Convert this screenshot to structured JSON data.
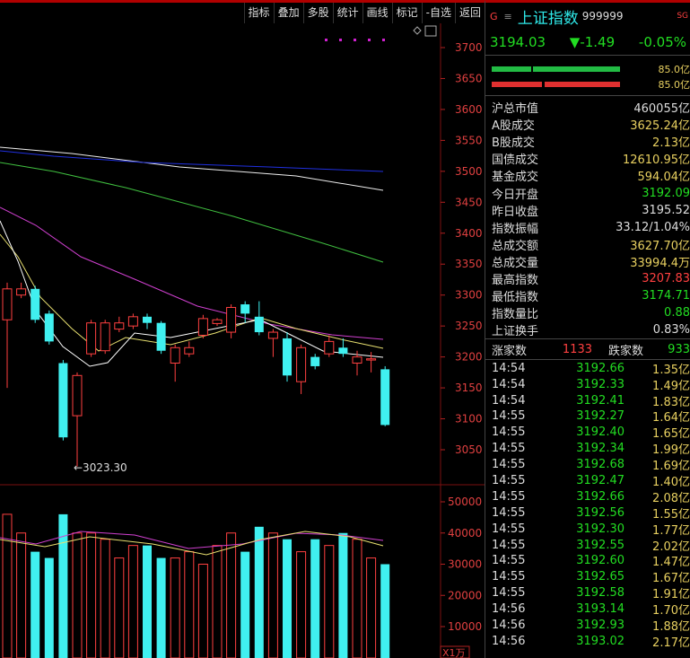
{
  "toolbar": [
    "指标",
    "叠加",
    "多股",
    "统计",
    "画线",
    "标记",
    "-自选",
    "返回"
  ],
  "header": {
    "g": "G",
    "menu": "≡",
    "name": "上证指数",
    "code": "999999",
    "tag": "SG",
    "price": "3194.03",
    "change": "▼-1.49",
    "pct": "-0.05%"
  },
  "volume_bars": [
    {
      "value": "85.0亿"
    },
    {
      "value": "85.0亿"
    }
  ],
  "stats": [
    {
      "label": "沪总市值",
      "value": "460055亿",
      "color": "#dddddd"
    },
    {
      "label": "A股成交",
      "value": "3625.24亿",
      "color": "#e8d060"
    },
    {
      "label": "B股成交",
      "value": "2.13亿",
      "color": "#e8d060"
    },
    {
      "label": "国债成交",
      "value": "12610.95亿",
      "color": "#e8d060"
    },
    {
      "label": "基金成交",
      "value": "594.04亿",
      "color": "#e8d060"
    },
    {
      "label": "今日开盘",
      "value": "3192.09",
      "color": "#22dd22"
    },
    {
      "label": "昨日收盘",
      "value": "3195.52",
      "color": "#dddddd"
    },
    {
      "label": "指数振幅",
      "value": "33.12/1.04%",
      "color": "#dddddd"
    },
    {
      "label": "总成交额",
      "value": "3627.70亿",
      "color": "#e8d060"
    },
    {
      "label": "总成交量",
      "value": "33994.4万",
      "color": "#e8d060"
    },
    {
      "label": "最高指数",
      "value": "3207.83",
      "color": "#ff4040"
    },
    {
      "label": "最低指数",
      "value": "3174.71",
      "color": "#22dd22"
    },
    {
      "label": "指数量比",
      "value": "0.88",
      "color": "#22dd22"
    },
    {
      "label": "上证换手",
      "value": "0.83%",
      "color": "#dddddd"
    }
  ],
  "updown": {
    "up_label": "涨家数",
    "up": "1133",
    "down_label": "跌家数",
    "down": "933"
  },
  "ticks": [
    [
      "14:54",
      "3192.66",
      "1.35亿"
    ],
    [
      "14:54",
      "3192.33",
      "1.49亿"
    ],
    [
      "14:54",
      "3192.41",
      "1.83亿"
    ],
    [
      "14:55",
      "3192.27",
      "1.64亿"
    ],
    [
      "14:55",
      "3192.40",
      "1.65亿"
    ],
    [
      "14:55",
      "3192.34",
      "1.99亿"
    ],
    [
      "14:55",
      "3192.68",
      "1.69亿"
    ],
    [
      "14:55",
      "3192.47",
      "1.40亿"
    ],
    [
      "14:55",
      "3192.66",
      "2.08亿"
    ],
    [
      "14:55",
      "3192.56",
      "1.55亿"
    ],
    [
      "14:55",
      "3192.30",
      "1.77亿"
    ],
    [
      "14:55",
      "3192.55",
      "2.02亿"
    ],
    [
      "14:55",
      "3192.60",
      "1.47亿"
    ],
    [
      "14:55",
      "3192.65",
      "1.67亿"
    ],
    [
      "14:55",
      "3192.58",
      "1.91亿"
    ],
    [
      "14:56",
      "3193.14",
      "1.70亿"
    ],
    [
      "14:56",
      "3192.93",
      "1.88亿"
    ],
    [
      "14:56",
      "3193.02",
      "2.17亿"
    ]
  ],
  "chart_data": {
    "type": "candlestick",
    "price_axis": [
      3700,
      3650,
      3600,
      3550,
      3500,
      3450,
      3400,
      3350,
      3300,
      3250,
      3200,
      3150,
      3100,
      3050
    ],
    "volume_axis": [
      50000,
      40000,
      30000,
      20000,
      10000
    ],
    "volume_unit": "X1万",
    "low_annotation": "←3023.30",
    "candles": [
      {
        "o": 3260,
        "c": 3310,
        "h": 3320,
        "l": 3150
      },
      {
        "o": 3300,
        "c": 3310,
        "h": 3320,
        "l": 3295
      },
      {
        "o": 3310,
        "c": 3260,
        "h": 3315,
        "l": 3255
      },
      {
        "o": 3270,
        "c": 3225,
        "h": 3275,
        "l": 3220
      },
      {
        "o": 3190,
        "c": 3070,
        "h": 3195,
        "l": 3065
      },
      {
        "o": 3105,
        "c": 3170,
        "h": 3175,
        "l": 3023
      },
      {
        "o": 3205,
        "c": 3255,
        "h": 3260,
        "l": 3200
      },
      {
        "o": 3210,
        "c": 3255,
        "h": 3260,
        "l": 3205
      },
      {
        "o": 3245,
        "c": 3255,
        "h": 3265,
        "l": 3240
      },
      {
        "o": 3250,
        "c": 3265,
        "h": 3270,
        "l": 3245
      },
      {
        "o": 3265,
        "c": 3255,
        "h": 3270,
        "l": 3245
      },
      {
        "o": 3255,
        "c": 3210,
        "h": 3258,
        "l": 3205
      },
      {
        "o": 3190,
        "c": 3215,
        "h": 3220,
        "l": 3160
      },
      {
        "o": 3205,
        "c": 3215,
        "h": 3225,
        "l": 3200
      },
      {
        "o": 3235,
        "c": 3262,
        "h": 3268,
        "l": 3230
      },
      {
        "o": 3254,
        "c": 3260,
        "h": 3263,
        "l": 3250
      },
      {
        "o": 3240,
        "c": 3280,
        "h": 3285,
        "l": 3230
      },
      {
        "o": 3285,
        "c": 3270,
        "h": 3290,
        "l": 3255
      },
      {
        "o": 3265,
        "c": 3240,
        "h": 3290,
        "l": 3235
      },
      {
        "o": 3230,
        "c": 3240,
        "h": 3245,
        "l": 3200
      },
      {
        "o": 3230,
        "c": 3170,
        "h": 3240,
        "l": 3160
      },
      {
        "o": 3160,
        "c": 3215,
        "h": 3220,
        "l": 3140
      },
      {
        "o": 3200,
        "c": 3185,
        "h": 3205,
        "l": 3180
      },
      {
        "o": 3205,
        "c": 3225,
        "h": 3235,
        "l": 3200
      },
      {
        "o": 3215,
        "c": 3205,
        "h": 3230,
        "l": 3200
      },
      {
        "o": 3190,
        "c": 3200,
        "h": 3210,
        "l": 3170
      },
      {
        "o": 3195,
        "c": 3197,
        "h": 3208,
        "l": 3175
      },
      {
        "o": 3180,
        "c": 3090,
        "h": 3185,
        "l": 3088
      }
    ],
    "volumes": [
      46000,
      40000,
      34000,
      32000,
      46000,
      40000,
      40000,
      38000,
      32000,
      36000,
      36000,
      32000,
      32000,
      34000,
      30000,
      36000,
      40000,
      34000,
      42000,
      40000,
      38000,
      34000,
      38000,
      36000,
      40000,
      38000,
      32000,
      30000
    ]
  }
}
